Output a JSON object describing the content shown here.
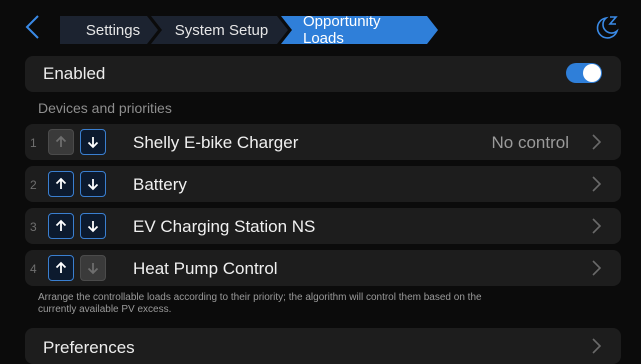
{
  "breadcrumbs": [
    "Settings",
    "System Setup",
    "Opportunity Loads"
  ],
  "accent_color": "#2f7fd9",
  "enabled": {
    "label": "Enabled",
    "on": true
  },
  "section_title": "Devices and priorities",
  "devices": [
    {
      "index": "1",
      "name": "Shelly E-bike Charger",
      "status": "No control",
      "up_enabled": false,
      "down_enabled": true
    },
    {
      "index": "2",
      "name": "Battery",
      "status": "",
      "up_enabled": true,
      "down_enabled": true
    },
    {
      "index": "3",
      "name": "EV Charging Station NS",
      "status": "",
      "up_enabled": true,
      "down_enabled": true
    },
    {
      "index": "4",
      "name": "Heat Pump Control",
      "status": "",
      "up_enabled": true,
      "down_enabled": false
    }
  ],
  "hint": "Arrange the controllable loads according to their priority; the algorithm will control them based on the currently available PV excess.",
  "preferences_label": "Preferences",
  "icons": [
    "back-chevron-icon",
    "sleep-moon-icon",
    "arrow-up-icon",
    "arrow-down-icon",
    "chevron-right-icon"
  ]
}
